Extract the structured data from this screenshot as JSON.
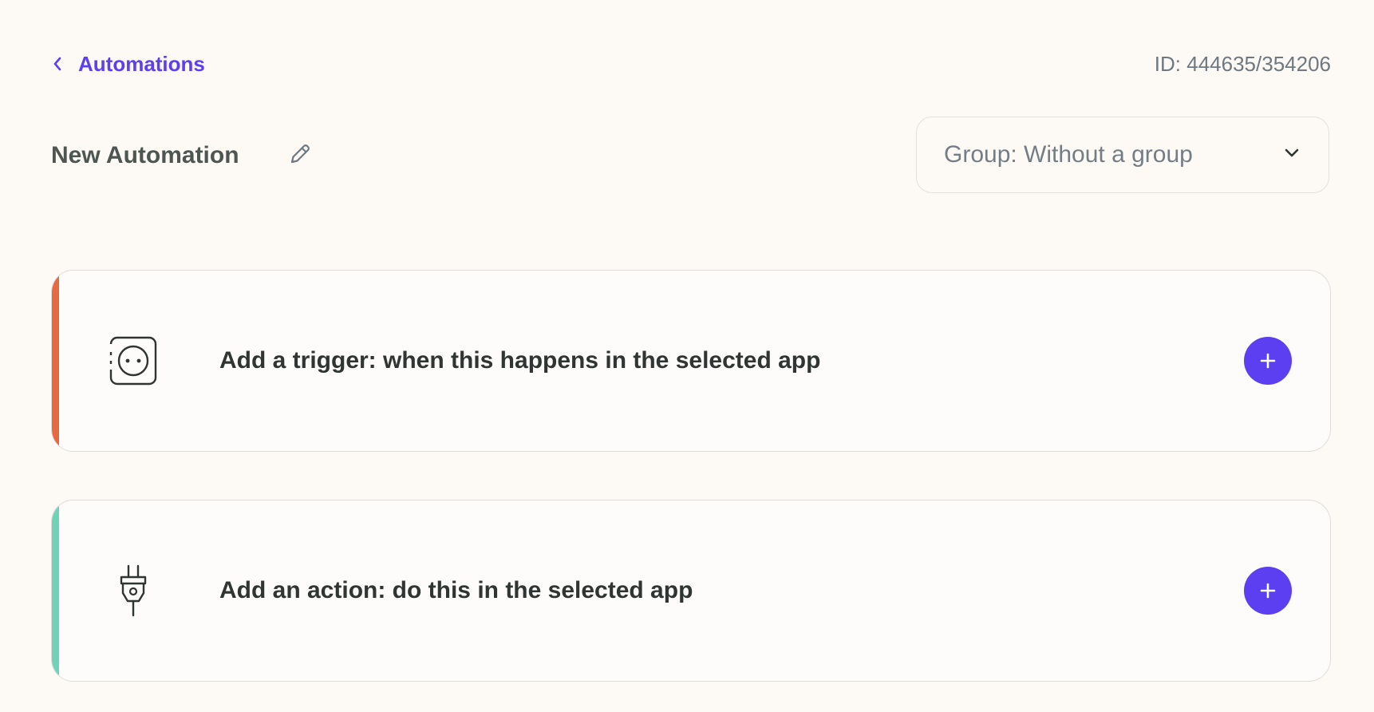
{
  "header": {
    "back_label": "Automations",
    "id_text": "ID: 444635/354206"
  },
  "title_row": {
    "title": "New Automation",
    "group_select_label": "Group: Without a group"
  },
  "steps": [
    {
      "kind": "trigger",
      "label": "Add a trigger: when this happens in the selected app",
      "icon": "socket-icon",
      "accent_color": "#e8693f",
      "add_symbol": "+"
    },
    {
      "kind": "action",
      "label": "Add an action: do this in the selected app",
      "icon": "plug-icon",
      "accent_color": "#6fd3b8",
      "add_symbol": "+"
    }
  ],
  "colors": {
    "brand": "#5b3ff0",
    "background": "#fdfaf6"
  }
}
